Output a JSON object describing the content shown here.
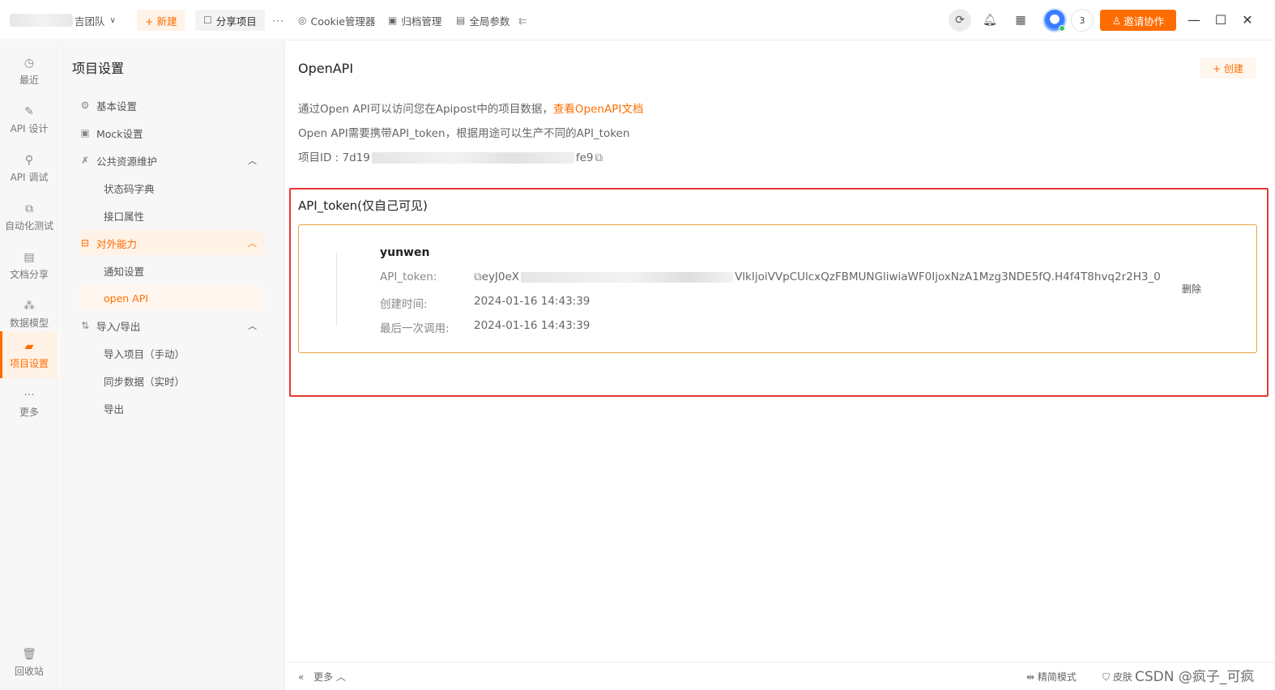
{
  "topbar": {
    "team_name": "吉团队",
    "new_label": "+ 新建",
    "share_label": "分享项目",
    "more_label": "···",
    "cookie_label": "Cookie管理器",
    "archive_label": "归档管理",
    "globals_label": "全局参数",
    "online_count": "3",
    "invite_label": "邀请协作"
  },
  "leftnav": {
    "items": [
      {
        "label": "最近"
      },
      {
        "label": "API 设计"
      },
      {
        "label": "API 调试"
      },
      {
        "label": "自动化测试"
      },
      {
        "label": "文档分享"
      },
      {
        "label": "数据模型"
      },
      {
        "label": "项目设置"
      },
      {
        "label": "更多"
      }
    ],
    "trash_label": "回收站"
  },
  "settings_menu": {
    "title": "项目设置",
    "basic": "基本设置",
    "mock": "Mock设置",
    "public_resources": "公共资源维护",
    "status_codes": "状态码字典",
    "api_attributes": "接口属性",
    "external": "对外能力",
    "notifications": "通知设置",
    "open_api": "open API",
    "import_export": "导入/导出",
    "import_manual": "导入项目（手动）",
    "sync_data": "同步数据（实时）",
    "export": "导出"
  },
  "main": {
    "title": "OpenAPI",
    "create_label": "+ 创建",
    "desc1": "通过Open API可以访问您在Apipost中的项目数据，",
    "desc1_link": "查看OpenAPI文档",
    "desc2": "Open API需要携带API_token，根据用途可以生产不同的API_token",
    "project_id_label": "项目ID : 7d19",
    "project_id_tail": "fe9",
    "token_section_title": "API_token(仅自己可见)",
    "token": {
      "name": "yunwen",
      "token_label": "API_token:",
      "token_prefix": "eyJ0eX",
      "token_suffix": "VlkIjoiVVpCUlcxQzFBMUNGliwiaWF0IjoxNzA1Mzg3NDE5fQ.H4f4T8hvq2r2H3_0",
      "created_label": "创建时间:",
      "created_value": "2024-01-16 14:43:39",
      "last_used_label": "最后一次调用:",
      "last_used_value": "2024-01-16 14:43:39",
      "delete_label": "删除"
    }
  },
  "footer": {
    "more_label": "更多",
    "mode_label": "精简模式",
    "skin_label": "皮肤",
    "watermark": "CSDN @疯子_可疯"
  },
  "colors": {
    "accent": "#ff6c00",
    "highlight_frame": "#e53935",
    "card_border": "#e8a23c"
  }
}
